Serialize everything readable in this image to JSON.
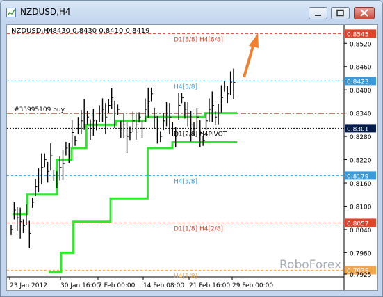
{
  "window": {
    "title": "NZDUSD,H4",
    "minimize_label": "",
    "maximize_label": "",
    "close_label": ""
  },
  "chart_header": {
    "symbol": "NZDUSD,H4",
    "ohlc": "0.8430 0.8430 0.8410 0.8419"
  },
  "watermark": "RoboForex",
  "order_label": "#33995109 buy",
  "colors": {
    "price": "#000000",
    "green": "#2ee82e",
    "red": "#e00000",
    "blue_line": "#3a9ad9",
    "red_line": "#e0442a",
    "orange_line": "#f3a64a",
    "arrow": "#f07f2f"
  },
  "chart_data": {
    "type": "line",
    "ylim": [
      0.7925,
      0.856
    ],
    "y_ticks": [
      "0.8520",
      "0.8460",
      "0.8400",
      "0.8340",
      "0.8280",
      "0.8220",
      "0.8160",
      "0.8100",
      "0.8040",
      "0.7980",
      "0.7925"
    ],
    "x_ticks": [
      "23 Jan 2012",
      "30 Jan 16:00",
      "7 Feb 00:00",
      "14 Feb 08:00",
      "21 Feb 16:00",
      "29 Feb 00:00"
    ],
    "levels": [
      {
        "label": "D1[3/8] H4[8/8]",
        "value": 0.8545,
        "price_label": "0.8545",
        "style": "red"
      },
      {
        "label": "H4[5/8]",
        "value": 0.8423,
        "price_label": "0.8423",
        "style": "blue"
      },
      {
        "label": "",
        "value": 0.8339,
        "price_label": "",
        "style": "red-dashdot"
      },
      {
        "label": "D1[2/8] H4PIVOT",
        "value": 0.8301,
        "price_label": "0.8301",
        "style": "black"
      },
      {
        "label": "H4[3/8]",
        "value": 0.8179,
        "price_label": "0.8179",
        "style": "blue"
      },
      {
        "label": "D1[1/8] H4[2/8]",
        "value": 0.8057,
        "price_label": "0.8057",
        "style": "red"
      },
      {
        "label": "H4[1/8]",
        "value": 0.7935,
        "price_label": "0.7935",
        "style": "orange"
      }
    ],
    "price_series": [
      0.804,
      0.809,
      0.807,
      0.806,
      0.805,
      0.808,
      0.803,
      0.811,
      0.815,
      0.817,
      0.82,
      0.822,
      0.819,
      0.823,
      0.818,
      0.817,
      0.82,
      0.821,
      0.825,
      0.824,
      0.829,
      0.827,
      0.831,
      0.832,
      0.834,
      0.833,
      0.83,
      0.832,
      0.831,
      0.834,
      0.835,
      0.833,
      0.836,
      0.838,
      0.834,
      0.835,
      0.83,
      0.831,
      0.828,
      0.829,
      0.832,
      0.831,
      0.833,
      0.83,
      0.835,
      0.837,
      0.839,
      0.833,
      0.83,
      0.828,
      0.832,
      0.834,
      0.833,
      0.83,
      0.828,
      0.836,
      0.838,
      0.835,
      0.834,
      0.831,
      0.83,
      0.833,
      0.829,
      0.827,
      0.832,
      0.835,
      0.836,
      0.833,
      0.834,
      0.838,
      0.841,
      0.839,
      0.842,
      0.8419
    ],
    "green_steps": [
      [
        0.793,
        0.798,
        0.806,
        0.806,
        0.806,
        0.812,
        0.812,
        0.812,
        0.825,
        0.825,
        0.8265,
        0.8265,
        0.8265,
        0.8265,
        0.8265,
        0.8265
      ],
      [
        0.808,
        0.813,
        0.813,
        0.822,
        0.825,
        0.831,
        0.831,
        0.832,
        0.832,
        0.833,
        0.833,
        0.833,
        0.833,
        0.834,
        0.834,
        0.834
      ]
    ]
  }
}
